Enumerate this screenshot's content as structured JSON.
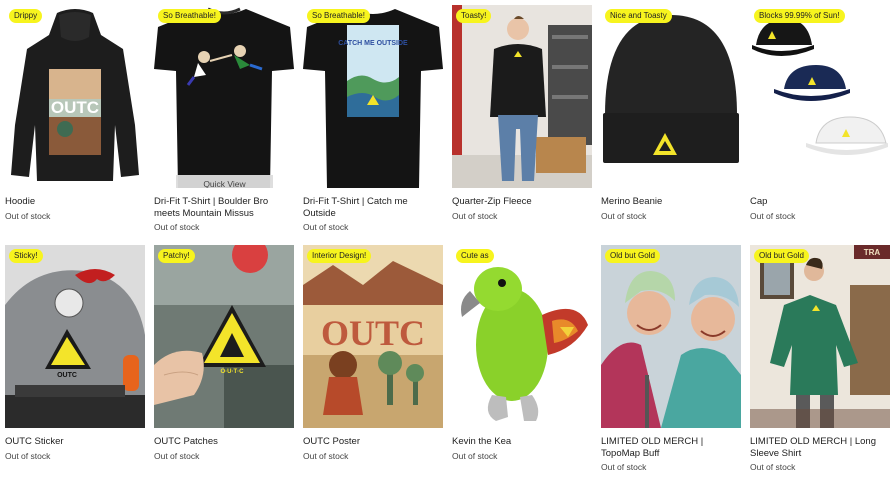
{
  "quick_view_label": "Quick View",
  "products": [
    {
      "title": "Hoodie",
      "badge": "Drippy",
      "status": "Out of stock"
    },
    {
      "title": "Dri-Fit T-Shirt | Boulder Bro meets Mountain Missus",
      "badge": "So Breathable!",
      "status": "Out of stock"
    },
    {
      "title": "Dri-Fit T-Shirt | Catch me Outside",
      "badge": "So Breathable!",
      "status": "Out of stock"
    },
    {
      "title": "Quarter-Zip Fleece",
      "badge": "Toasty!",
      "status": "Out of stock"
    },
    {
      "title": "Merino Beanie",
      "badge": "Nice and Toasty",
      "status": "Out of stock"
    },
    {
      "title": "Cap",
      "badge": "Blocks 99.99% of Sun!",
      "status": "Out of stock"
    },
    {
      "title": "OUTC Sticker",
      "badge": "Sticky!",
      "status": "Out of stock"
    },
    {
      "title": "OUTC Patches",
      "badge": "Patchy!",
      "status": "Out of stock"
    },
    {
      "title": "OUTC Poster",
      "badge": "Interior Design!",
      "status": "Out of stock"
    },
    {
      "title": "Kevin the Kea",
      "badge": "Cute as",
      "status": "Out of stock"
    },
    {
      "title": "LIMITED OLD MERCH | TopoMap Buff",
      "badge": "Old but Gold",
      "status": "Out of stock"
    },
    {
      "title": "LIMITED OLD MERCH | Long Sleeve Shirt",
      "badge": "Old but Gold",
      "status": "Out of stock"
    }
  ],
  "art_text": {
    "hoodie_print": "OUTC",
    "poster_big": "OUTC",
    "sticker": "OUTC",
    "patch": "O·U·T·C",
    "shirt_print": "CATCH ME OUTSIDE",
    "sign": "TRA"
  }
}
